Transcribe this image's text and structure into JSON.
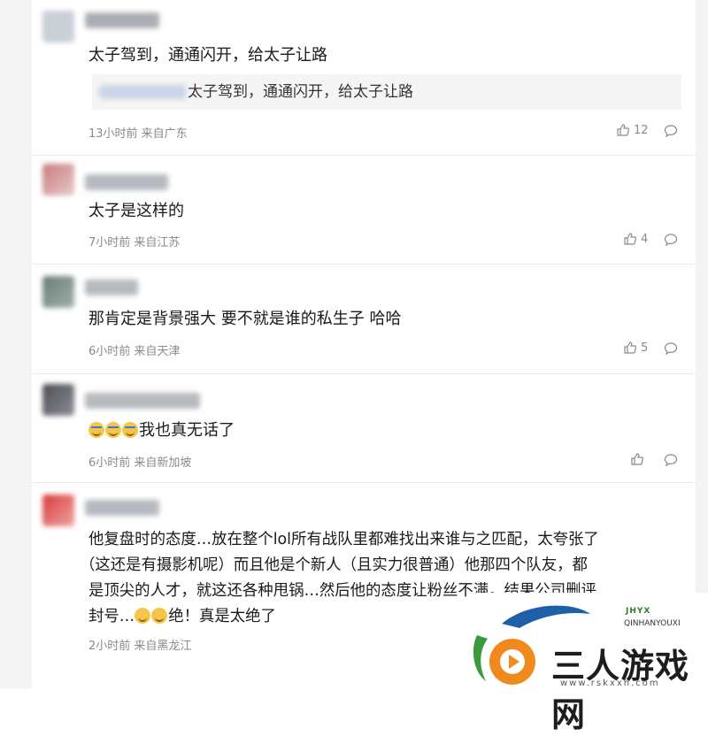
{
  "comments": [
    {
      "text": "太子驾到，通通闪开，给太子让路",
      "quote": "太子驾到，通通闪开，给太子让路",
      "meta": "13小时前 来自广东",
      "likes": "12"
    },
    {
      "text": "太子是这样的",
      "meta": "7小时前 来自江苏",
      "likes": "4"
    },
    {
      "text": "那肯定是背景强大 要不就是谁的私生子 哈哈",
      "meta": "6小时前 来自天津",
      "likes": "5"
    },
    {
      "text": "我也真无话了",
      "meta": "6小时前 来自新加坡",
      "likes": ""
    },
    {
      "lines": [
        "他复盘时的态度…放在整个lol所有战队里都难找出来谁与之匹配，太夸张了",
        "（这还是有摄影机呢）而且他是个新人（且实力很普通）他那四个队友，都",
        "是顶尖的人才，就这还各种甩锅…然后他的态度让粉丝不满，结果公司删评"
      ],
      "last_prefix": "封号…",
      "last_suffix": "绝！真是太绝了",
      "meta": "2小时前 来自黑龙江"
    }
  ],
  "watermark": {
    "name": "三人游戏网",
    "url": "www.rskxxh.com",
    "brand": "JHYX",
    "brand_sub": "QINHANYOUXI"
  },
  "icons": {
    "like": "thumbs-up-icon",
    "reply": "comment-bubble-icon",
    "laugh": "laugh-emoji-icon",
    "cry": "cry-emoji-icon"
  },
  "colors": {
    "avatar1": "#c8cfd6",
    "avatar2": "#c97b7b",
    "avatar3": "#6c7d79",
    "avatar4": "#4d4d52",
    "avatar5": "#d83a3a",
    "meta": "#8a8a8a",
    "quote_bg": "#f5f5f5"
  }
}
